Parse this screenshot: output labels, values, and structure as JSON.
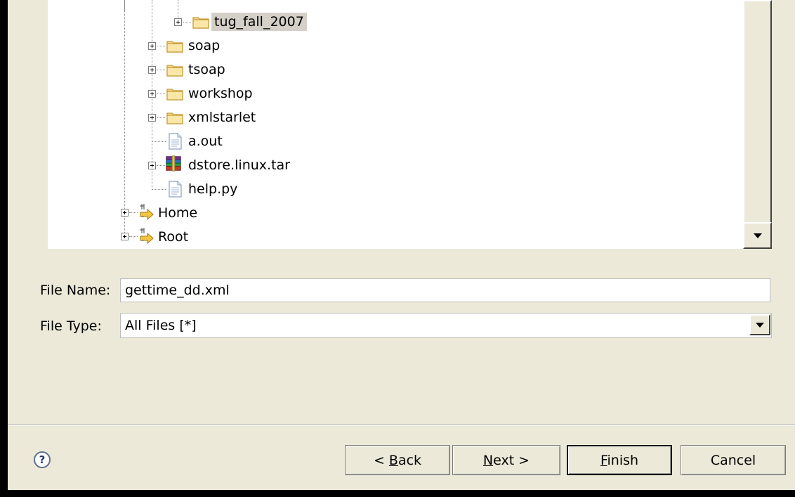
{
  "tree": {
    "nodes": [
      {
        "label": "tug_fall_2007",
        "icon": "folder-icon",
        "selected": true
      },
      {
        "label": "soap",
        "icon": "folder-icon"
      },
      {
        "label": "tsoap",
        "icon": "folder-icon"
      },
      {
        "label": "workshop",
        "icon": "folder-icon"
      },
      {
        "label": "xmlstarlet",
        "icon": "folder-icon"
      },
      {
        "label": "a.out",
        "icon": "file-icon"
      },
      {
        "label": "dstore.linux.tar",
        "icon": "archive-icon"
      },
      {
        "label": "help.py",
        "icon": "file-icon"
      },
      {
        "label": "Home",
        "icon": "link-icon"
      },
      {
        "label": "Root",
        "icon": "link-icon"
      }
    ]
  },
  "form": {
    "file_name_label": "File Name:",
    "file_name_value": "gettime_dd.xml",
    "file_type_label": "File Type:",
    "file_type_value": "All Files [*]"
  },
  "buttons": {
    "help": "?",
    "back_prefix": "< ",
    "back_mnemonic": "B",
    "back_rest": "ack",
    "next_mnemonic": "N",
    "next_rest": "ext >",
    "finish_mnemonic": "F",
    "finish_rest": "inish",
    "cancel": "Cancel"
  },
  "colors": {
    "dialog_bg": "#ece9d8",
    "folder": "#f3d27a",
    "selection": "#d4d0c8"
  }
}
